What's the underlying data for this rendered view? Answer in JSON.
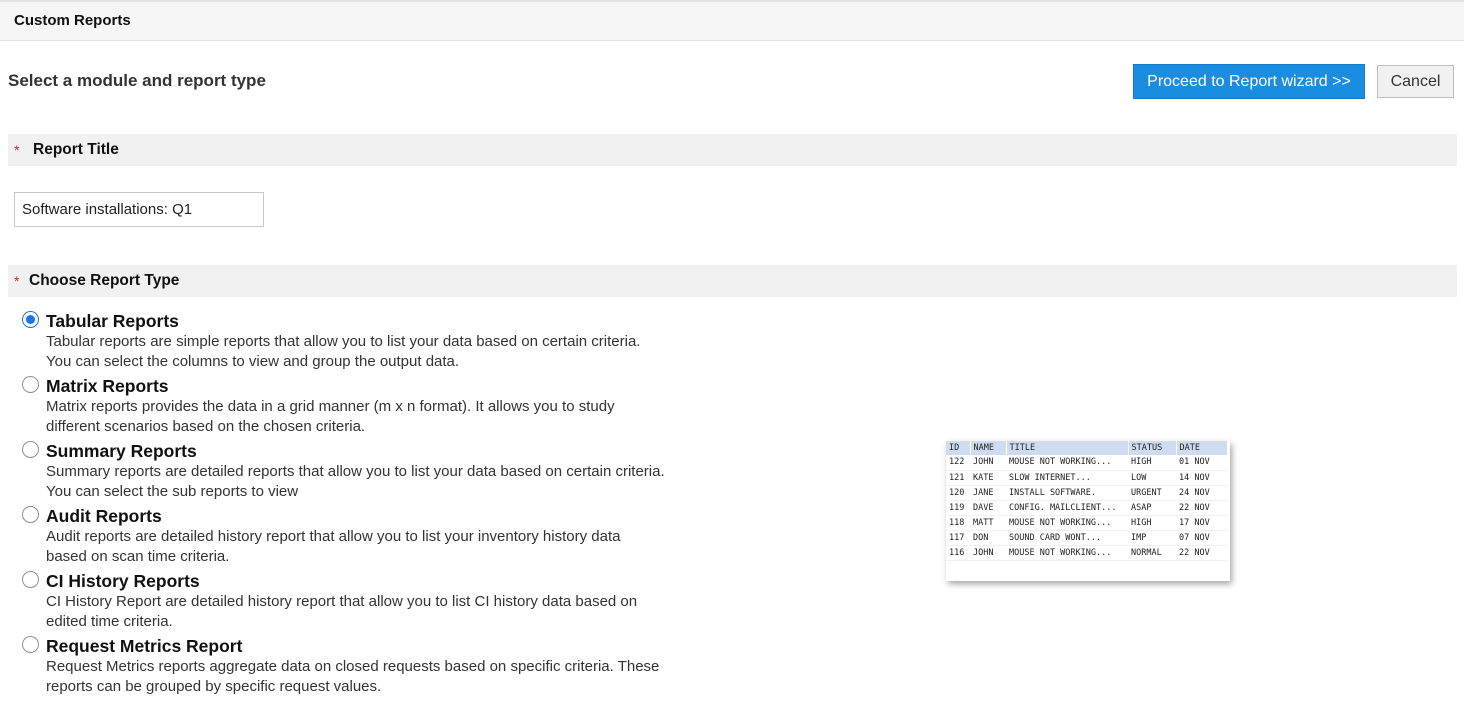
{
  "header": {
    "title": "Custom Reports"
  },
  "subheading": "Select a module and report type",
  "buttons": {
    "proceed": "Proceed to Report wizard >>",
    "cancel": "Cancel"
  },
  "report_title_section": {
    "required_mark": "*",
    "label": "Report Title",
    "value": "Software installations: Q1"
  },
  "report_type_section": {
    "required_mark": "*",
    "label": "Choose Report Type"
  },
  "report_types": [
    {
      "title": "Tabular Reports",
      "checked": true,
      "desc1": "Tabular reports are simple reports that allow you to list your data based on certain criteria.",
      "desc2": "You can select the columns to view and group the output data."
    },
    {
      "title": "Matrix Reports",
      "checked": false,
      "desc1": "Matrix reports provides the data in a grid manner (m x n format). It allows you to study",
      "desc2": "different scenarios based on the chosen criteria."
    },
    {
      "title": "Summary Reports",
      "checked": false,
      "desc1": "Summary reports are detailed reports that allow you to list your data based on certain criteria.",
      "desc2": "You can select the sub reports to view"
    },
    {
      "title": "Audit Reports",
      "checked": false,
      "desc1": "Audit reports are detailed history report that allow you to list your inventory history data",
      "desc2": "based on scan time criteria."
    },
    {
      "title": "CI History Reports",
      "checked": false,
      "desc1": "CI History Report are detailed history report that allow you to list CI history data based on",
      "desc2": "edited time criteria."
    },
    {
      "title": "Request Metrics Report",
      "checked": false,
      "desc1": "Request Metrics reports aggregate data on closed requests based on specific criteria. These",
      "desc2": "reports can be grouped by specific request values."
    }
  ],
  "preview": {
    "headers": [
      "ID",
      "NAME",
      "TITLE",
      "STATUS",
      "DATE"
    ],
    "rows": [
      [
        "122",
        "JOHN",
        "MOUSE NOT WORKING...",
        "HIGH",
        "01 NOV"
      ],
      [
        "121",
        "KATE",
        "SLOW INTERNET...",
        "LOW",
        "14 NOV"
      ],
      [
        "120",
        "JANE",
        "INSTALL SOFTWARE.",
        "URGENT",
        "24 NOV"
      ],
      [
        "119",
        "DAVE",
        "CONFIG. MAILCLIENT...",
        "ASAP",
        "22 NOV"
      ],
      [
        "118",
        "MATT",
        "MOUSE NOT WORKING...",
        "HIGH",
        "17 NOV"
      ],
      [
        "117",
        "DON",
        "SOUND CARD WONT...",
        "IMP",
        "07 NOV"
      ],
      [
        "116",
        "JOHN",
        "MOUSE NOT WORKING...",
        "NORMAL",
        "22 NOV"
      ]
    ]
  },
  "colors": {
    "primary_button": "#1a8de0",
    "required": "#e02020",
    "radio_checked": "#1a73e8"
  }
}
